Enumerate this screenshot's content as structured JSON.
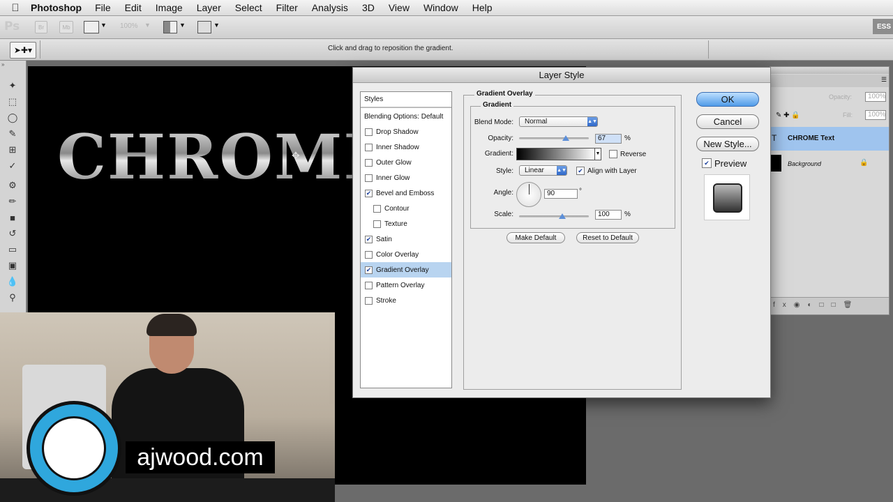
{
  "menu_bar": {
    "app_name": "Photoshop",
    "items": [
      "File",
      "Edit",
      "Image",
      "Layer",
      "Select",
      "Filter",
      "Analysis",
      "3D",
      "View",
      "Window",
      "Help"
    ]
  },
  "app_bar": {
    "logo": "Ps",
    "bridge_label": "Br",
    "minibridge_label": "Mb",
    "zoom_value": "100%",
    "workspace_label": "ESS"
  },
  "options_bar": {
    "hint": "Click and drag to reposition the gradient."
  },
  "canvas": {
    "text": "CHROME"
  },
  "layers_panel": {
    "opacity_label": "Opacity:",
    "opacity_value": "100%",
    "fill_label": "Fill:",
    "fill_value": "100%",
    "layers": [
      {
        "name": "CHROME Text",
        "type_icon": "T"
      },
      {
        "name": "Background"
      }
    ]
  },
  "video_overlay": {
    "site": "ajwood.com"
  },
  "dialog": {
    "title": "Layer Style",
    "styles_header": "Styles",
    "blending_label": "Blending Options: Default",
    "styles": [
      {
        "label": "Drop Shadow",
        "checked": false,
        "indent": false
      },
      {
        "label": "Inner Shadow",
        "checked": false,
        "indent": false
      },
      {
        "label": "Outer Glow",
        "checked": false,
        "indent": false
      },
      {
        "label": "Inner Glow",
        "checked": false,
        "indent": false
      },
      {
        "label": "Bevel and Emboss",
        "checked": true,
        "indent": false
      },
      {
        "label": "Contour",
        "checked": false,
        "indent": true
      },
      {
        "label": "Texture",
        "checked": false,
        "indent": true
      },
      {
        "label": "Satin",
        "checked": true,
        "indent": false
      },
      {
        "label": "Color Overlay",
        "checked": false,
        "indent": false
      },
      {
        "label": "Gradient Overlay",
        "checked": true,
        "indent": false,
        "selected": true
      },
      {
        "label": "Pattern Overlay",
        "checked": false,
        "indent": false
      },
      {
        "label": "Stroke",
        "checked": false,
        "indent": false
      }
    ],
    "section_title": "Gradient Overlay",
    "sub_title": "Gradient",
    "blend_mode_label": "Blend Mode:",
    "blend_mode_value": "Normal",
    "opacity_label": "Opacity:",
    "opacity_value": "67",
    "opacity_level": 0.67,
    "percent_sign": "%",
    "gradient_label": "Gradient:",
    "reverse_label": "Reverse",
    "reverse_checked": false,
    "style_label": "Style:",
    "style_value": "Linear",
    "align_label": "Align with Layer",
    "align_checked": true,
    "angle_label": "Angle:",
    "angle_value": "90",
    "degree_sign": "°",
    "scale_label": "Scale:",
    "scale_value": "100",
    "make_default": "Make Default",
    "reset_default": "Reset to Default",
    "ok_label": "OK",
    "cancel_label": "Cancel",
    "new_style_label": "New Style...",
    "preview_label": "Preview",
    "preview_checked": true
  }
}
